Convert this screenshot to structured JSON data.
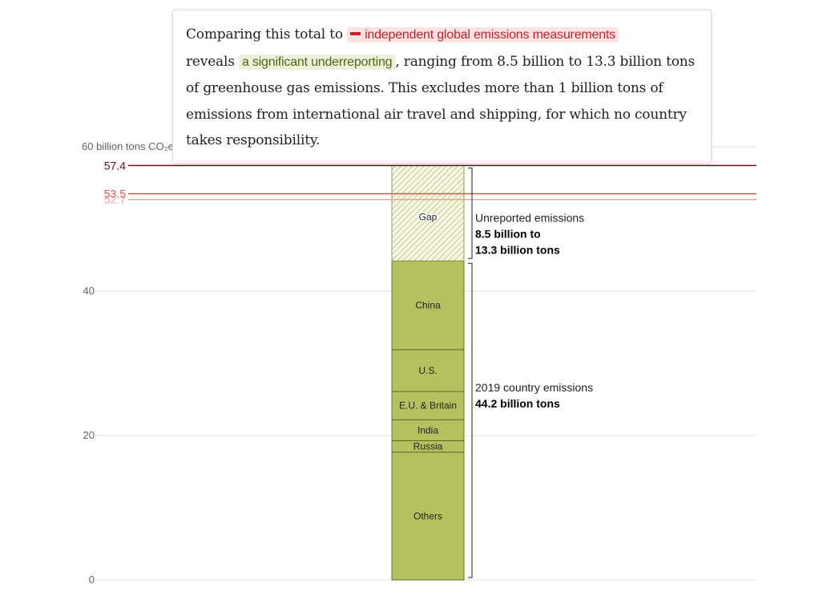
{
  "annotation": {
    "before_red": "Comparing this total to ",
    "red_chip": "independent global emissions measurements",
    "middle": "reveals ",
    "green_chip": "a significant underreporting",
    "after_green": ", ranging from 8.5 billion to 13.3 billion tons of greenhouse gas emissions. This excludes more than 1 billion tons of emissions from international air travel and shipping, for which no country takes responsibility."
  },
  "chart_data": {
    "type": "bar",
    "stacked": true,
    "unit_label": "60 billion tons CO₂e",
    "ylim": [
      0,
      60
    ],
    "yticks": [
      {
        "value": 0,
        "label": "0"
      },
      {
        "value": 20,
        "label": "20"
      },
      {
        "value": 40,
        "label": "40"
      },
      {
        "value": 60,
        "label": "60 billion tons CO₂e"
      }
    ],
    "grid": true,
    "segments": [
      {
        "name": "Others",
        "start": 0,
        "end": 17.7,
        "color": "#b5c05e"
      },
      {
        "name": "Russia",
        "start": 17.7,
        "end": 19.3,
        "color": "#b5c05e"
      },
      {
        "name": "India",
        "start": 19.3,
        "end": 22.2,
        "color": "#b5c05e"
      },
      {
        "name": "E.U. & Britain",
        "start": 22.2,
        "end": 26.1,
        "color": "#b5c05e"
      },
      {
        "name": "U.S.",
        "start": 26.1,
        "end": 31.9,
        "color": "#b5c05e"
      },
      {
        "name": "China",
        "start": 31.9,
        "end": 44.2,
        "color": "#b5c05e"
      },
      {
        "name": "Gap",
        "start": 44.2,
        "end": 57.4,
        "color": "#b5c05e",
        "hatched": true
      }
    ],
    "reference_lines": [
      {
        "value": 57.4,
        "label": "57.4",
        "color": "#6b0f12"
      },
      {
        "value": 53.5,
        "label": "53.5",
        "color": "#d9534f"
      },
      {
        "value": 52.7,
        "label": "52.7",
        "color": "#f4a194"
      }
    ],
    "brackets": [
      {
        "start": 44.2,
        "end": 57.4,
        "line1": "Unreported emissions",
        "line2": "8.5 billion to",
        "line3": "13.3 billion tons"
      },
      {
        "start": 0,
        "end": 44.2,
        "line1": "2019 country emissions",
        "line2": "44.2 billion tons",
        "line3": ""
      }
    ]
  }
}
